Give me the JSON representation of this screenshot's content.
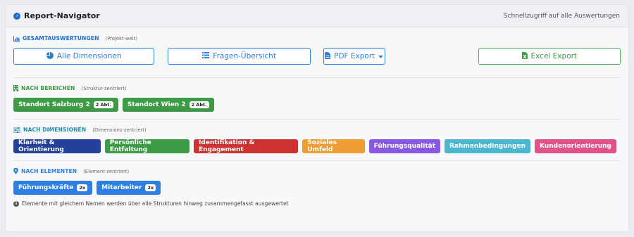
{
  "header": {
    "title": "Report-Navigator",
    "quick_access": "Schnellzugriff auf alle Auswertungen"
  },
  "overall": {
    "title": "GESAMTAUSWERTUNGEN",
    "subtitle": "(Projekt-weit)",
    "color": "#1f6fd1",
    "all_dimensions": "Alle Dimensionen",
    "questions_overview": "Fragen-Übersicht",
    "pdf_export": "PDF Export",
    "excel_export": "Excel Export"
  },
  "areas": {
    "title": "NACH BEREICHEN",
    "subtitle": "(Struktur-zentriert)",
    "color": "#3a9a42",
    "items": [
      {
        "label": "Standort Salzburg 2",
        "badge": "2 Abt."
      },
      {
        "label": "Standort Wien 2",
        "badge": "2 Abt."
      }
    ]
  },
  "dimensions": {
    "title": "NACH DIMENSIONEN",
    "subtitle": "(Dimensions-zentriert)",
    "color": "#1e8fa8",
    "items": [
      {
        "label": "Klarheit & Orientierung",
        "color": "#23409a"
      },
      {
        "label": "Persönliche Entfaltung",
        "color": "#3d9a45"
      },
      {
        "label": "Identifikation & Engagement",
        "color": "#cf3030"
      },
      {
        "label": "Soziales Umfeld",
        "color": "#ee9d35"
      },
      {
        "label": "Führungsqualität",
        "color": "#8758e0"
      },
      {
        "label": "Rahmenbedingungen",
        "color": "#4db6cf"
      },
      {
        "label": "Kundenorientierung",
        "color": "#e05288"
      }
    ]
  },
  "elements": {
    "title": "NACH ELEMENTEN",
    "subtitle": "(Element-zentriert)",
    "color": "#2d7fe3",
    "items": [
      {
        "label": "Führungskräfte",
        "badge": "2x"
      },
      {
        "label": "Mitarbeiter",
        "badge": "2x"
      }
    ],
    "note": "Elemente mit gleichem Namen werden über alle Strukturen hinweg zusammengefasst ausgewertet"
  }
}
